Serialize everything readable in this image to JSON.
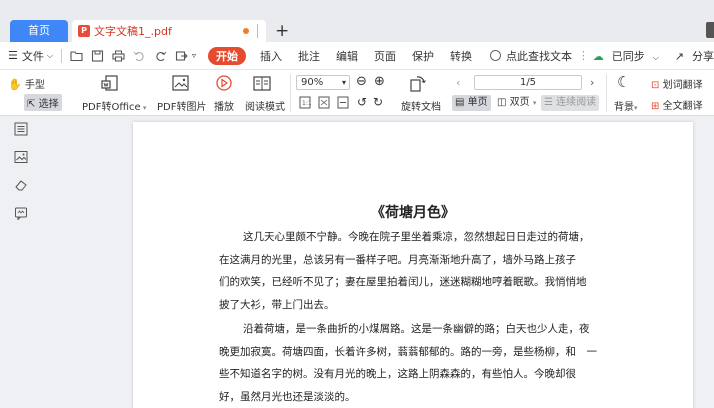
{
  "tabs": {
    "home": "首页",
    "doc_title": "文字文稿1_.pdf",
    "add": "+"
  },
  "menubar": {
    "file": "文件",
    "items": [
      "开始",
      "插入",
      "批注",
      "编辑",
      "页面",
      "保护",
      "转换"
    ],
    "search": "点此查找文本",
    "sync": "已同步",
    "share": "分享"
  },
  "ribbon": {
    "hand_tool": "手型",
    "select_tool": "选择",
    "pdf_to_office": "PDF转Office",
    "pdf_to_image": "PDF转图片",
    "play": "播放",
    "read_mode": "阅读模式",
    "zoom_value": "90%",
    "rotate_doc": "旋转文档",
    "page_indicator": "1/5",
    "single_page": "单页",
    "double_page": "双页",
    "continuous": "连续阅读",
    "background": "背景",
    "word_translate": "划词翻译",
    "full_translate": "全文翻译"
  },
  "document": {
    "title": "《荷塘月色》",
    "paragraph1": [
      "这几天心里颇不宁静。今晚在院子里坐着乘凉，忽然想起日日走过的荷塘，",
      "在这满月的光里，总该另有一番样子吧。月亮渐渐地升高了，墙外马路上孩子",
      "们的欢笑，已经听不见了；妻在屋里拍着闰儿，迷迷糊糊地哼着眠歌。我悄悄地",
      "披了大衫，带上门出去。"
    ],
    "paragraph2": [
      "沿着荷塘，是一条曲折的小煤屑路。这是一条幽僻的路；白天也少人走，夜",
      "晚更加寂寞。荷塘四面，长着许多树，蓊蓊郁郁的。路的一旁，是些杨柳，和　一",
      "些不知道名字的树。没有月光的晚上，这路上阴森森的，有些怕人。今晚却很",
      "好，虽然月光也还是淡淡的。"
    ]
  },
  "colors": {
    "accent": "#3f86f7",
    "active_menu": "#e64b2f",
    "doc_tab_text": "#d9341f"
  }
}
